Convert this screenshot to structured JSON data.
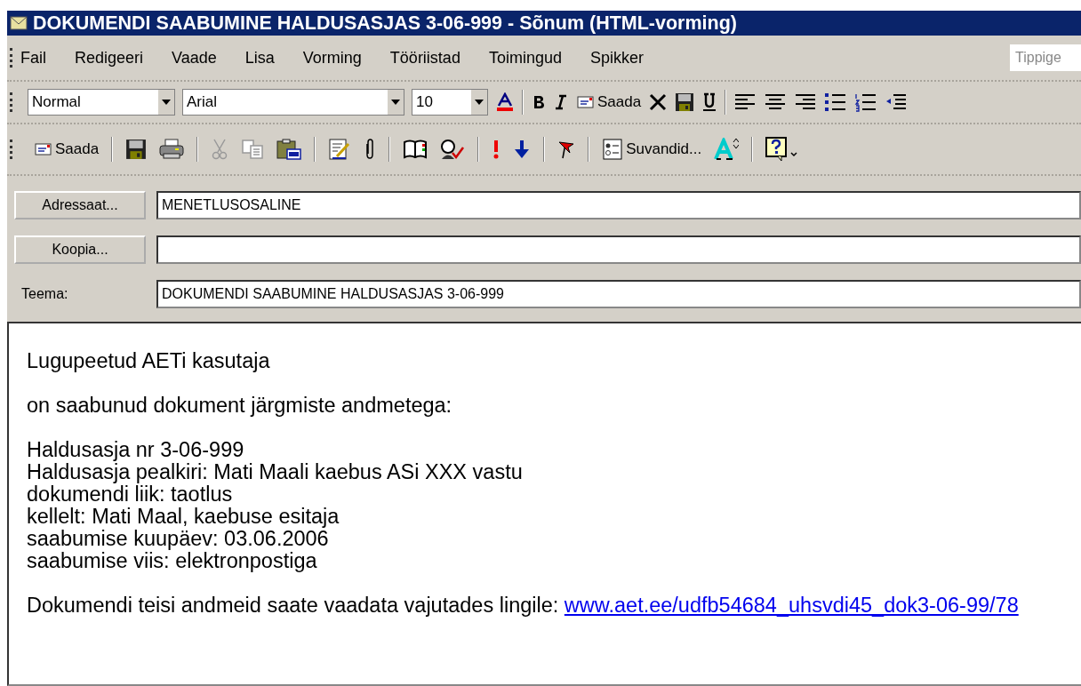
{
  "window": {
    "title": "DOKUMENDI SAABUMINE HALDUSASJAS 3-06-999 - Sõnum (HTML-vorming)"
  },
  "menu": [
    "Fail",
    "Redigeeri",
    "Vaade",
    "Lisa",
    "Vorming",
    "Tööriistad",
    "Toimingud",
    "Spikker"
  ],
  "help_search": {
    "placeholder": "Tippige"
  },
  "format_toolbar": {
    "style": "Normal",
    "font": "Arial",
    "size": "10",
    "send_label": "Saada"
  },
  "standard_toolbar": {
    "send_label": "Saada",
    "cut_disabled": true,
    "copy_disabled": true,
    "options_label": "Suvandid..."
  },
  "fields": [
    {
      "kind": "button",
      "label": "Adressaat...",
      "value": "MENETLUSOSALINE"
    },
    {
      "kind": "button",
      "label": "Koopia..."
    },
    {
      "kind": "label",
      "label": "Teema:",
      "value": "DOKUMENDI SAABUMINE HALDUSASJAS 3-06-999"
    }
  ],
  "body": {
    "paragraphs": [
      [
        "Lugupeetud AETi kasutaja"
      ],
      [
        "on saabunud dokument järgmiste andmetega:"
      ],
      [
        "Haldusasja nr 3-06-999",
        "Haldusasja pealkiri: Mati Maali kaebus ASi XXX vastu",
        "dokumendi liik: taotlus",
        "kellelt: Mati Maal, kaebuse esitaja",
        "saabumise kuupäev: 03.06.2006",
        "saabumise viis: elektronpostiga"
      ]
    ],
    "link_sentence": {
      "text": "Dokumendi teisi andmeid saate vaadata vajutades lingile:",
      "link": "www.aet.ee/udfb54684_uhsvdi45_dok3-06-99/78"
    }
  }
}
